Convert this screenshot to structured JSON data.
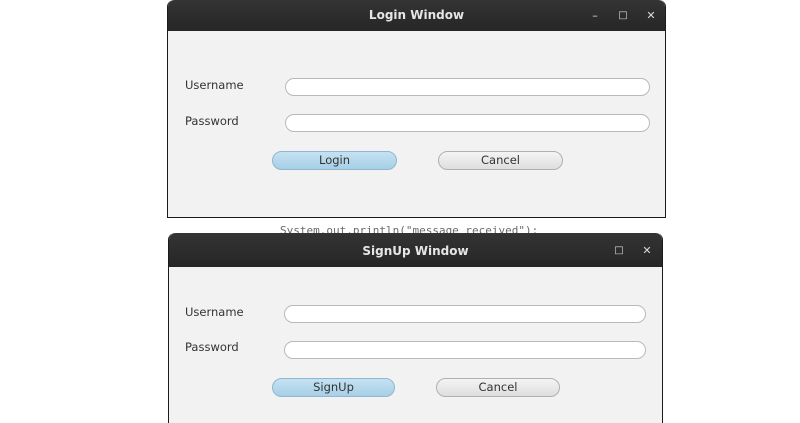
{
  "background_text": "System.out.println(\"message received\");",
  "login_window": {
    "title": "Login Window",
    "controls": {
      "minimize": "–",
      "maximize": "□",
      "close": "✕"
    },
    "username_label": "Username",
    "password_label": "Password",
    "username_value": "",
    "password_value": "",
    "login_button": "Login",
    "cancel_button": "Cancel"
  },
  "signup_window": {
    "title": "SignUp Window",
    "controls": {
      "maximize": "□",
      "close": "✕"
    },
    "username_label": "Username",
    "password_label": "Password",
    "username_value": "",
    "password_value": "",
    "signup_button": "SignUp",
    "cancel_button": "Cancel"
  },
  "colors": {
    "titlebar": "#2c2c2c",
    "window_bg": "#f2f2f2",
    "default_button": "#b3d8ec",
    "normal_button": "#e6e6e6"
  }
}
